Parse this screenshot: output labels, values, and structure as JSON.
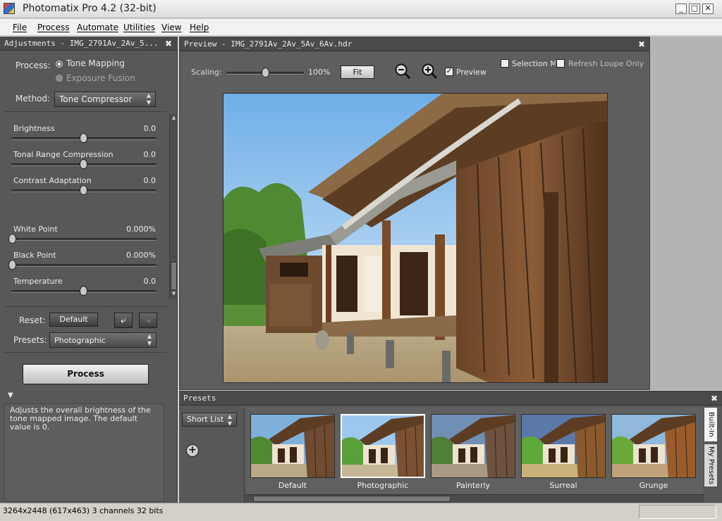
{
  "window": {
    "title": "Photomatix Pro 4.2 (32-bit)",
    "min_glyph": "_",
    "max_glyph": "□",
    "close_glyph": "✕"
  },
  "menu": [
    "File",
    "Process",
    "Automate",
    "Utilities",
    "View",
    "Help"
  ],
  "adjustments": {
    "header": "Adjustments - IMG_2791Av_2Av_5...",
    "close_glyph": "✖",
    "process_label": "Process:",
    "process_options": [
      {
        "label": "Tone Mapping",
        "selected": true
      },
      {
        "label": "Exposure Fusion",
        "selected": false
      }
    ],
    "method_label": "Method:",
    "method_value": "Tone Compressor",
    "sliders": [
      {
        "label": "Brightness",
        "value": "0.0",
        "position": 0.5
      },
      {
        "label": "Tonal Range Compression",
        "value": "0.0",
        "position": 0.5
      },
      {
        "label": "Contrast Adaptation",
        "value": "0.0",
        "position": 0.5
      },
      {
        "label": "White Point",
        "value": "0.000%",
        "position": 0.0
      },
      {
        "label": "Black Point",
        "value": "0.000%",
        "position": 0.0
      },
      {
        "label": "Temperature",
        "value": "0.0",
        "position": 0.5
      }
    ],
    "reset_label": "Reset:",
    "reset_button": "Default",
    "presets_label": "Presets:",
    "presets_value": "Photographic",
    "process_button": "Process",
    "help_toggle": "▼",
    "help_text": "Adjusts the overall brightness of the tone mapped image. The default value is 0."
  },
  "preview": {
    "header": "Preview - IMG_2791Av_2Av_5Av_6Av.hdr",
    "close_glyph": "✖",
    "scaling_label": "Scaling:",
    "scaling_value": "100%",
    "scaling_position": 0.5,
    "fit_button": "Fit",
    "preview_checkbox": {
      "label": "Preview",
      "checked": true
    },
    "selection_checkbox": {
      "label": "Selection Mo",
      "checked": false
    },
    "refresh_checkbox": {
      "label": "Refresh Loupe Only",
      "checked": false
    }
  },
  "presets_panel": {
    "header": "Presets",
    "close_glyph": "✖",
    "list_dropdown": "Short List",
    "add_glyph": "+",
    "thumbnails": [
      {
        "label": "Default",
        "selected": false
      },
      {
        "label": "Photographic",
        "selected": true
      },
      {
        "label": "Painterly",
        "selected": false
      },
      {
        "label": "Surreal",
        "selected": false
      },
      {
        "label": "Grunge",
        "selected": false
      }
    ],
    "tabs": [
      "Built-In",
      "My Presets"
    ]
  },
  "status": {
    "text": "3264x2448 (617x463) 3 channels 32 bits"
  },
  "colors": {
    "panel": "#585858",
    "header": "#4a4a4a",
    "sky": "#9cc8ee",
    "wood": "#5a3a22"
  }
}
